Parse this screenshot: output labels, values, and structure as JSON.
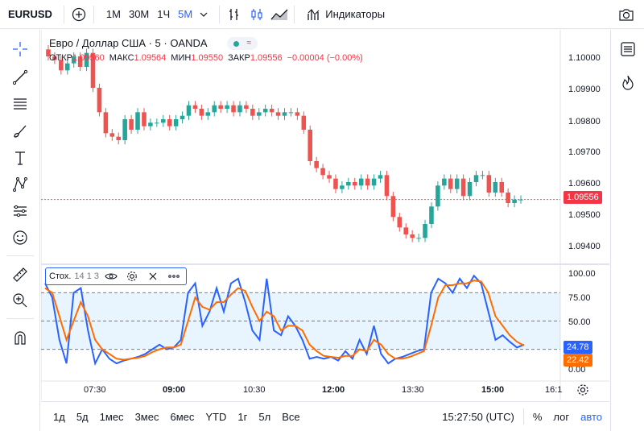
{
  "topbar": {
    "symbol": "EURUSD",
    "intervals": [
      "1М",
      "30М",
      "1Ч",
      "5М"
    ],
    "active_interval": "5М",
    "indicators_label": "Индикаторы"
  },
  "legend": {
    "title": "Евро / Доллар США · 5 · OANDA",
    "open_label": "ОТКР",
    "open": "1.09560",
    "high_label": "МАКС",
    "high": "1.09564",
    "low_label": "МИН",
    "low": "1.09550",
    "close_label": "ЗАКР",
    "close": "1.09556",
    "change": "−0.00004 (−0.00%)"
  },
  "price_axis": {
    "ticks": [
      "1.10000",
      "1.09900",
      "1.09800",
      "1.09700",
      "1.09600",
      "1.09500",
      "1.09400"
    ],
    "current_price": "1.09556"
  },
  "stoch": {
    "label": "Стох.",
    "params": "14 1 3",
    "axis_ticks": [
      "100.00",
      "75.00",
      "50.00",
      "25.00",
      "0.00"
    ],
    "k_value": "24.78",
    "d_value": "22.42"
  },
  "time_axis": {
    "ticks": [
      "07:30",
      "09:00",
      "10:30",
      "12:00",
      "13:30",
      "15:00",
      "16:1"
    ]
  },
  "bottombar": {
    "ranges": [
      "1д",
      "5д",
      "1мес",
      "3мес",
      "6мес",
      "YTD",
      "1г",
      "5л",
      "Все"
    ],
    "clock": "15:27:50 (UTC)",
    "percent": "%",
    "log": "лог",
    "auto": "авто"
  },
  "colors": {
    "up": "#26a69a",
    "down": "#ef5350",
    "k_line": "#2962ff",
    "d_line": "#ff6d00",
    "accent": "#2962ff"
  },
  "chart_data": {
    "type": "candlestick",
    "price_series": [
      1.0997,
      1.0996,
      1.0993,
      1.0995,
      1.0997,
      1.0994,
      1.0998,
      1.0988,
      1.0981,
      1.0975,
      1.0974,
      1.0973,
      1.0979,
      1.0976,
      1.0981,
      1.0977,
      1.0978,
      1.0978,
      1.0979,
      1.0977,
      1.0979,
      1.098,
      1.0983,
      1.0982,
      1.098,
      1.0981,
      1.0983,
      1.0982,
      1.0983,
      1.0981,
      1.0983,
      1.0982,
      1.098,
      1.0981,
      1.0982,
      1.0981,
      1.098,
      1.0981,
      1.0981,
      1.098,
      1.0976,
      1.0967,
      1.0965,
      1.0963,
      1.0962,
      1.0959,
      1.096,
      1.0961,
      1.096,
      1.0962,
      1.096,
      1.0962,
      1.0963,
      1.0957,
      1.0951,
      1.0948,
      1.0946,
      1.0945,
      1.0945,
      1.0949,
      1.0954,
      1.096,
      1.0962,
      1.0959,
      1.0962,
      1.0957,
      1.0961,
      1.0963,
      1.0963,
      1.0958,
      1.0961,
      1.0958,
      1.0955,
      1.0956,
      1.0956
    ],
    "stoch_k": [
      90,
      75,
      30,
      5,
      80,
      85,
      40,
      5,
      20,
      10,
      5,
      8,
      10,
      12,
      15,
      20,
      25,
      20,
      22,
      30,
      80,
      90,
      45,
      60,
      85,
      60,
      90,
      95,
      70,
      40,
      30,
      95,
      40,
      35,
      55,
      45,
      30,
      10,
      12,
      10,
      12,
      8,
      18,
      10,
      30,
      15,
      45,
      15,
      5,
      10,
      12,
      15,
      18,
      20,
      80,
      95,
      90,
      80,
      95,
      85,
      98,
      90,
      60,
      30,
      35,
      28,
      22,
      25
    ],
    "stoch_d": [
      85,
      80,
      55,
      30,
      50,
      70,
      55,
      30,
      20,
      15,
      10,
      9,
      10,
      11,
      13,
      17,
      20,
      22,
      22,
      25,
      50,
      75,
      65,
      62,
      70,
      70,
      78,
      85,
      82,
      65,
      50,
      60,
      55,
      40,
      45,
      45,
      40,
      25,
      18,
      13,
      12,
      11,
      13,
      13,
      20,
      18,
      30,
      25,
      15,
      10,
      10,
      12,
      15,
      18,
      45,
      75,
      88,
      88,
      90,
      90,
      93,
      92,
      80,
      55,
      45,
      35,
      28,
      24
    ],
    "ylim_price": [
      1.094,
      1.1
    ],
    "ylim_stoch": [
      0,
      100
    ]
  }
}
